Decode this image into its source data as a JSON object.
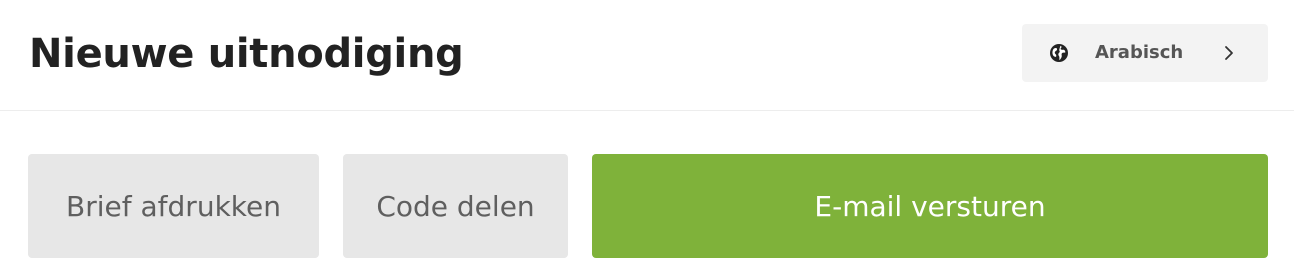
{
  "header": {
    "title": "Nieuwe uitnodiging",
    "language": {
      "label": "Arabisch",
      "icon": "globe-icon",
      "chevron_icon": "chevron-right-icon"
    }
  },
  "actions": {
    "print_label": "Brief afdrukken",
    "code_label": "Code delen",
    "email_label": "E-mail versturen"
  },
  "colors": {
    "accent_green": "#7fb23a",
    "secondary_grey": "#e7e7e7",
    "title_text": "#222222"
  }
}
